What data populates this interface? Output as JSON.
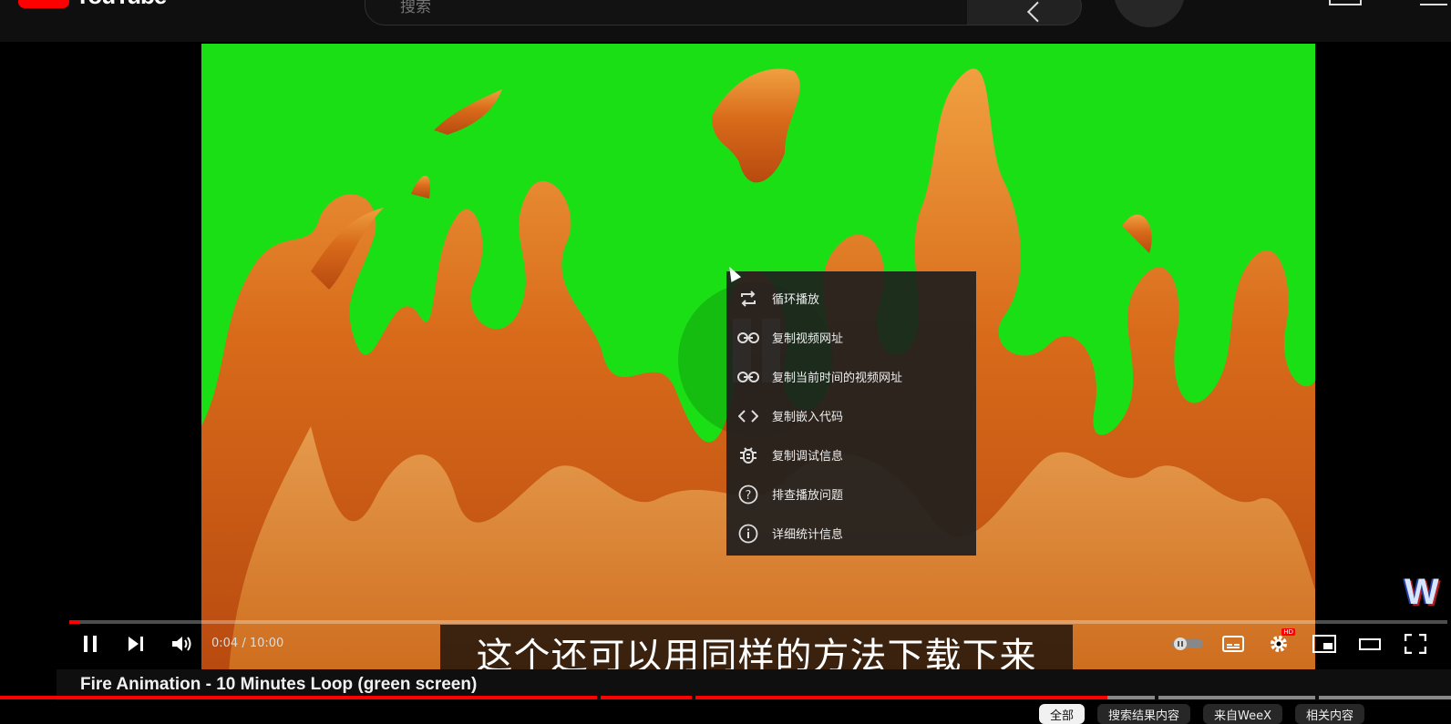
{
  "header": {
    "logo_text": "YouTube",
    "search_placeholder": "搜索"
  },
  "player": {
    "time_current": "0:04",
    "time_total": "10:00",
    "time_display": "0:04 / 10:00",
    "progress_fraction": 0.007,
    "hd_badge": "HD",
    "watermark": "W",
    "caption": "这个还可以用同样的方法下载下来"
  },
  "context_menu": {
    "items": [
      {
        "label": "循环播放",
        "icon": "loop-icon"
      },
      {
        "label": "复制视频网址",
        "icon": "link-icon"
      },
      {
        "label": "复制当前时间的视频网址",
        "icon": "link-icon"
      },
      {
        "label": "复制嵌入代码",
        "icon": "code-icon"
      },
      {
        "label": "复制调试信息",
        "icon": "bug-icon"
      },
      {
        "label": "排查播放问题",
        "icon": "help-icon"
      },
      {
        "label": "详细统计信息",
        "icon": "info-icon"
      }
    ]
  },
  "below_player": {
    "video_title": "Fire Animation - 10 Minutes Loop (green screen)",
    "chips": [
      "全部",
      "搜索结果内容",
      "来自WeeX",
      "相关内容"
    ]
  },
  "colors": {
    "accent": "#ff0000",
    "green_screen": "#1adf15",
    "menu_bg": "#1e1e1e"
  }
}
